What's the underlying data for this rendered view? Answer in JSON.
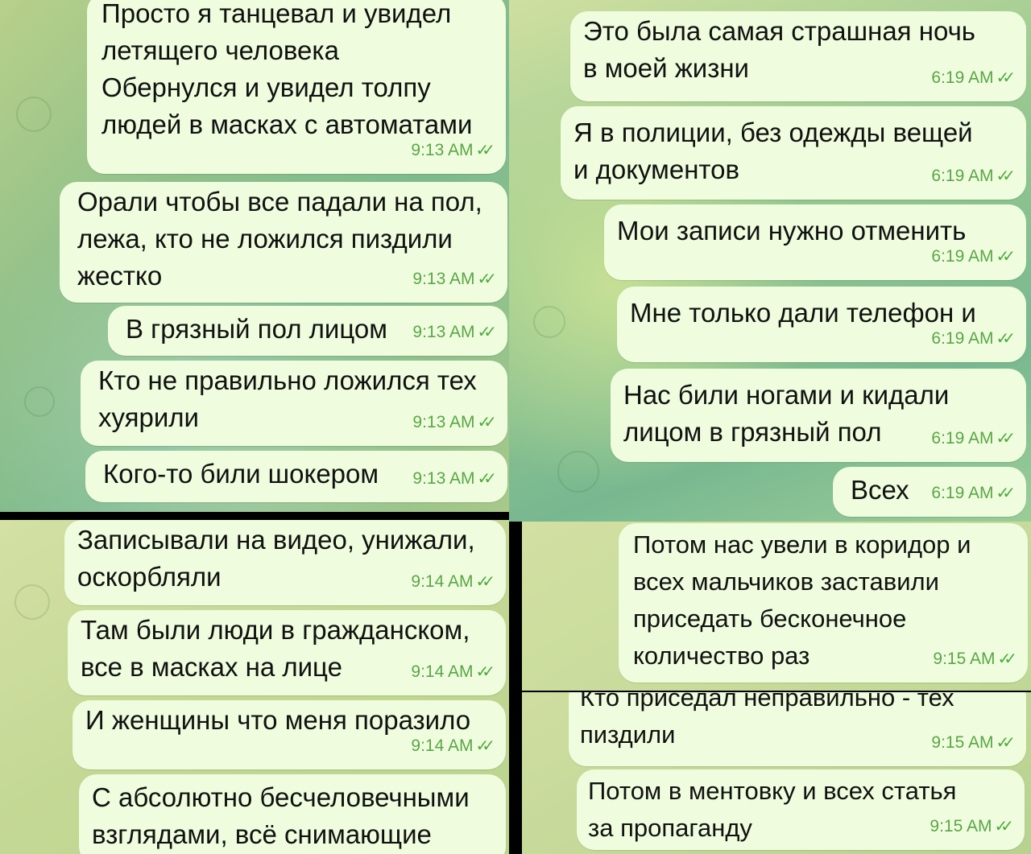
{
  "panels": {
    "top_left": {
      "messages": [
        {
          "text": "Просто я танцевал и увидел\nлетящего человека\nОбернулся и увидел толпу\nлюдей в масках с автоматами",
          "time": "9:13 AM"
        },
        {
          "text": "Орали чтобы все падали на пол,\nлежа, кто не ложился пиздили\nжестко",
          "time": "9:13 AM"
        },
        {
          "text": "В грязный пол лицом",
          "time": "9:13 AM"
        },
        {
          "text": "Кто не правильно ложился тех\nхуярили",
          "time": "9:13 AM"
        },
        {
          "text": "Кого-то били шокером",
          "time": "9:13 AM"
        }
      ]
    },
    "top_right": {
      "messages": [
        {
          "text": "Это была самая страшная ночь\nв моей жизни",
          "time": "6:19 AM"
        },
        {
          "text": "Я в полиции, без одежды вещей\nи документов",
          "time": "6:19 AM"
        },
        {
          "text": "Мои записи нужно отменить",
          "time": "6:19 AM"
        },
        {
          "text": "Мне только дали телефон и",
          "time": "6:19 AM"
        },
        {
          "text": "Нас били ногами и кидали\nлицом в грязный пол",
          "time": "6:19 AM"
        },
        {
          "text": "Всех",
          "time": "6:19 AM"
        }
      ]
    },
    "bottom_left": {
      "messages": [
        {
          "text": "Записывали на видео, унижали,\nоскорбляли",
          "time": "9:14 AM"
        },
        {
          "text": "Там были люди в гражданском,\nвсе в масках на лице",
          "time": "9:14 AM"
        },
        {
          "text": "И женщины что меня поразило",
          "time": "9:14 AM"
        },
        {
          "text": "С абсолютно бесчеловечными\nвзглядами, всё снимающие",
          "time": ""
        }
      ]
    },
    "bottom_right": {
      "messages": [
        {
          "text": "Потом нас увели в коридор и\nвсех мальчиков заставили\nприседать бесконечное\nколичество раз",
          "time": "9:15 AM"
        },
        {
          "text": "Кто приседал неправильно - тех\nпиздили",
          "time": "9:15 AM"
        },
        {
          "text": "Потом в ментовку и всех статья\nза пропаганду",
          "time": "9:15 AM"
        }
      ]
    }
  },
  "status": {
    "read_check": "✓✓",
    "check_color": "#4faa3e"
  },
  "colors": {
    "bubble": "#effdde",
    "time": "#5aa646"
  }
}
